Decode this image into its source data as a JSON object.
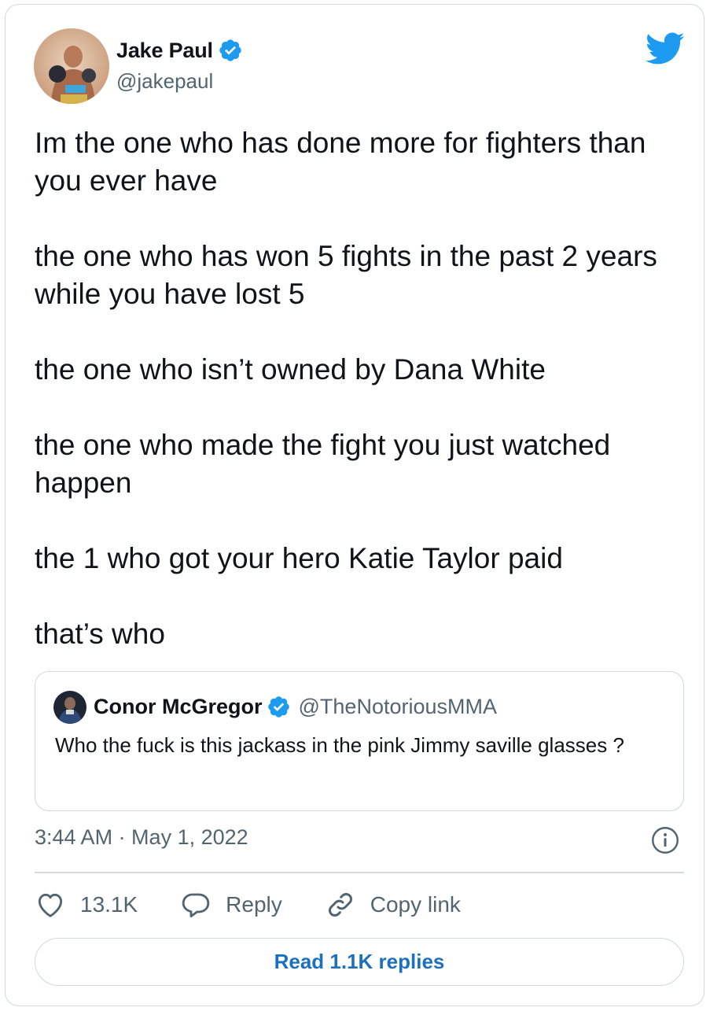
{
  "author": {
    "display_name": "Jake Paul",
    "handle": "@jakepaul",
    "verified": true
  },
  "tweet": {
    "paragraphs": [
      "Im the one who has done more for fighters than you ever have",
      "the one who has won 5 fights in the past 2 years while you have lost 5",
      "the one who isn’t owned by Dana White",
      "the one who made the fight you just watched happen",
      "the 1 who got your hero Katie Taylor paid",
      "that’s who"
    ]
  },
  "quoted_tweet": {
    "display_name": "Conor McGregor",
    "handle": "@TheNotoriousMMA",
    "verified": true,
    "text": "Who the fuck is this jackass in the pink Jimmy saville glasses ?"
  },
  "meta": {
    "timestamp": "3:44 AM · May 1, 2022"
  },
  "actions": {
    "like_count": "13.1K",
    "reply_label": "Reply",
    "copy_link_label": "Copy link"
  },
  "footer": {
    "read_replies_label": "Read 1.1K replies"
  },
  "colors": {
    "twitter_blue": "#1d9bf0",
    "link_blue": "#1d6fc2",
    "secondary_text": "#536471",
    "border": "#cfd9de"
  },
  "icons": {
    "brand": "twitter-bird-icon",
    "verified": "verified-badge-icon",
    "info": "info-icon",
    "like": "heart-icon",
    "reply": "speech-bubble-icon",
    "copy_link": "link-icon"
  }
}
